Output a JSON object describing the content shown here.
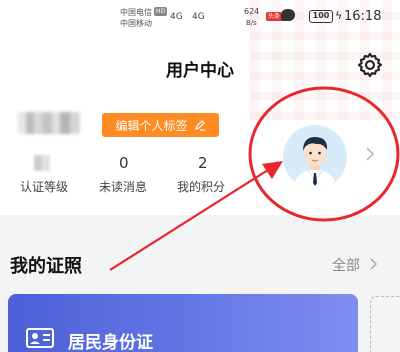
{
  "status_bar": {
    "carrier1": "中国电信",
    "carrier1_badge": "HD",
    "carrier2": "中国移动",
    "sig1": "4G",
    "sig2": "4G",
    "speed_value": "624",
    "speed_unit": "B/s",
    "app_badge": "头条",
    "battery": "100",
    "time": "16:18"
  },
  "header": {
    "title": "用户中心",
    "settings_icon": "gear-icon"
  },
  "profile": {
    "edit_tag_label": "编辑个人标签",
    "stats": [
      {
        "label": "认证等级",
        "value": ""
      },
      {
        "label": "未读消息",
        "value": "0"
      },
      {
        "label": "我的积分",
        "value": "2"
      }
    ],
    "avatar_icon": "user-avatar-icon"
  },
  "certificates": {
    "title": "我的证照",
    "view_all_label": "全部",
    "cards": [
      {
        "label": "居民身份证",
        "icon": "id-card-icon"
      }
    ]
  },
  "colors": {
    "accent_orange": "#ff8b24",
    "annotation_red": "#e8262b",
    "card_blue": "#5466d8"
  }
}
